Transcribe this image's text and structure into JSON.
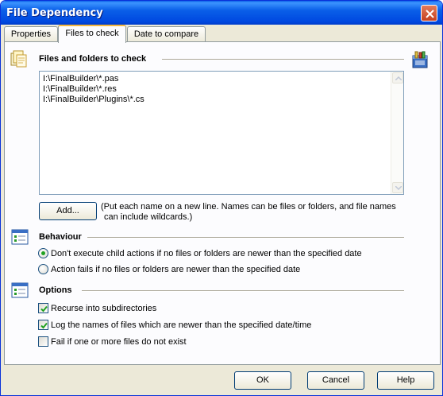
{
  "window": {
    "title": "File Dependency"
  },
  "tabs": [
    {
      "label": "Properties",
      "active": false
    },
    {
      "label": "Files to check",
      "active": true
    },
    {
      "label": "Date to compare",
      "active": false
    }
  ],
  "files_section": {
    "title": "Files and folders to check",
    "lines": [
      "I:\\FinalBuilder\\*.pas",
      "I:\\FinalBuilder\\*.res",
      "I:\\FinalBuilder\\Plugins\\*.cs"
    ],
    "add_button": "Add...",
    "hint_line1": "(Put each name on a new line. Names can be files or folders, and file names",
    "hint_line2": "can include wildcards.)"
  },
  "behaviour_section": {
    "title": "Behaviour",
    "options": [
      {
        "label": "Don't execute child actions if no files or folders are newer than the specified date",
        "selected": true
      },
      {
        "label": "Action fails if no files or folders are newer than the specified date",
        "selected": false
      }
    ]
  },
  "options_section": {
    "title": "Options",
    "checks": [
      {
        "label": "Recurse into subdirectories",
        "checked": true
      },
      {
        "label": "Log the names of files which are newer than the specified date/time",
        "checked": true
      },
      {
        "label": "Fail if one or more files do not exist",
        "checked": false
      }
    ]
  },
  "buttons": {
    "ok": "OK",
    "cancel": "Cancel",
    "help": "Help"
  },
  "colors": {
    "title_bar": "#0a5fe8",
    "dialog_face": "#ece9d8",
    "tab_highlight": "#f4b73f",
    "radio_dot": "#21a121",
    "check_mark": "#21a121"
  },
  "icons": [
    "files-section-icon",
    "toolbox-icon",
    "behaviour-section-icon",
    "options-section-icon",
    "close-icon"
  ]
}
